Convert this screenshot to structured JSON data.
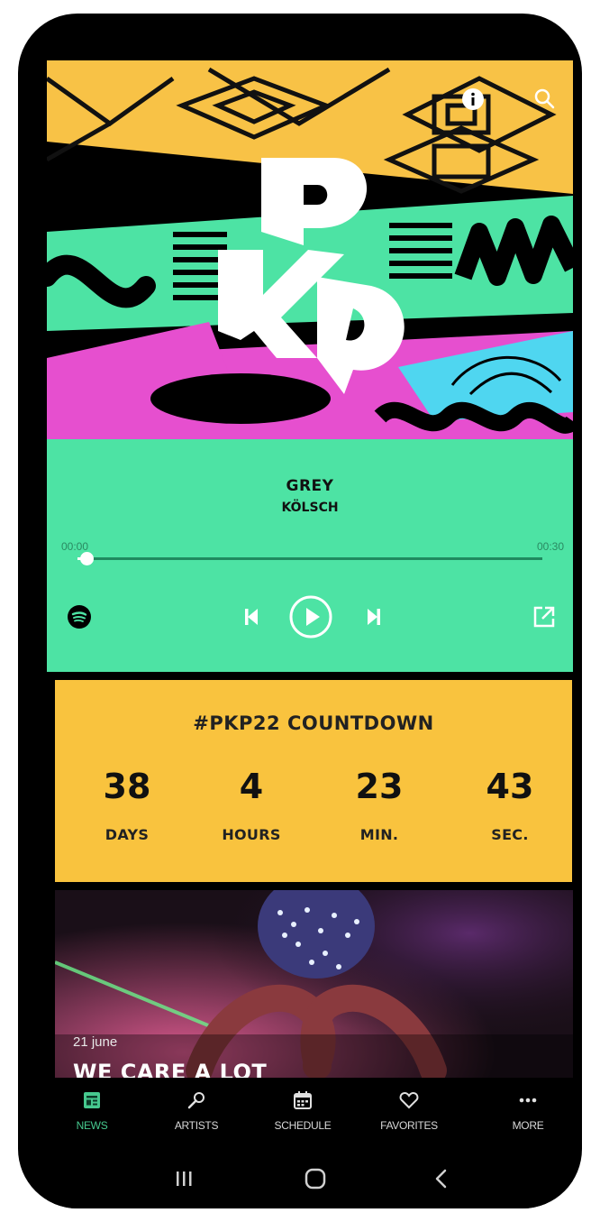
{
  "player": {
    "track_title": "GREY",
    "track_artist": "KÖLSCH",
    "time_elapsed": "00:00",
    "time_total": "00:30",
    "progress": 0.02
  },
  "countdown": {
    "title": "#PKP22 COUNTDOWN",
    "units": [
      {
        "value": "38",
        "label": "DAYS"
      },
      {
        "value": "4",
        "label": "HOURS"
      },
      {
        "value": "23",
        "label": "MIN."
      },
      {
        "value": "43",
        "label": "SEC."
      }
    ]
  },
  "news": {
    "date": "21 june",
    "title": "WE CARE A LOT"
  },
  "nav": {
    "items": [
      {
        "label": "NEWS",
        "icon": "news-icon",
        "active": true
      },
      {
        "label": "ARTISTS",
        "icon": "microphone-icon",
        "active": false
      },
      {
        "label": "SCHEDULE",
        "icon": "calendar-icon",
        "active": false
      },
      {
        "label": "FAVORITES",
        "icon": "heart-icon",
        "active": false
      },
      {
        "label": "MORE",
        "icon": "more-dots-icon",
        "active": false
      }
    ]
  },
  "colors": {
    "player_bg": "#4de3a4",
    "countdown_bg": "#f9c33e",
    "accent": "#46c98f",
    "hero_yellow": "#f8c246",
    "hero_pink": "#e64fcf",
    "hero_cyan": "#4fd6f0"
  }
}
